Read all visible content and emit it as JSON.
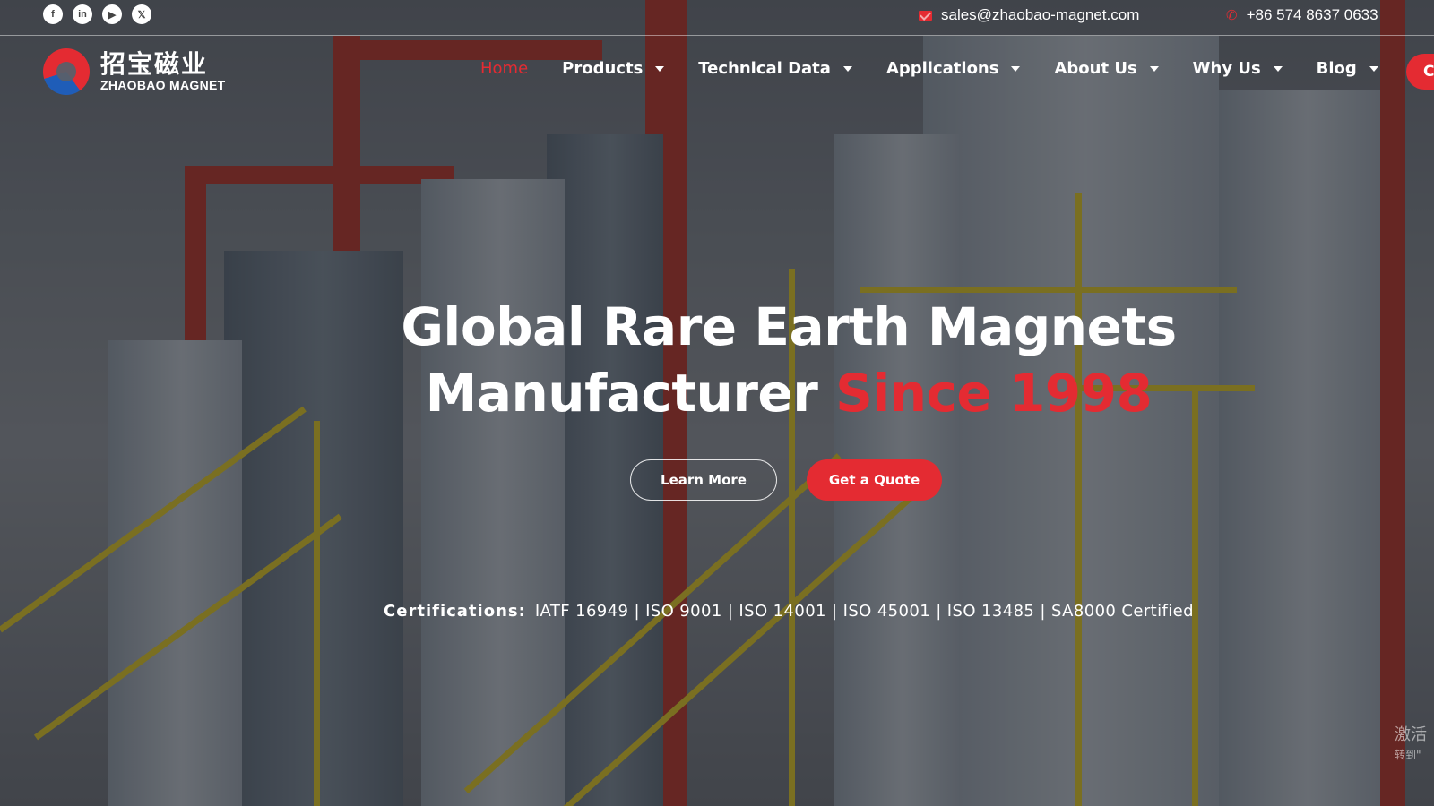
{
  "topbar": {
    "socials": [
      {
        "icon": "facebook-icon",
        "glyph": "f"
      },
      {
        "icon": "linkedin-icon",
        "glyph": "in"
      },
      {
        "icon": "youtube-icon",
        "glyph": "▶"
      },
      {
        "icon": "x-twitter-icon",
        "glyph": "𝕏"
      }
    ],
    "email": "sales@zhaobao-magnet.com",
    "phone": "+86 574 8637 0633"
  },
  "logo": {
    "cn": "招宝磁业",
    "en": "ZHAOBAO MAGNET"
  },
  "nav": {
    "items": [
      {
        "label": "Home",
        "active": true
      },
      {
        "label": "Products"
      },
      {
        "label": "Technical Data"
      },
      {
        "label": "Applications"
      },
      {
        "label": "About Us"
      },
      {
        "label": "Why Us"
      },
      {
        "label": "Blog"
      }
    ],
    "cta_label": "C"
  },
  "hero": {
    "title_line1": "Global Rare Earth Magnets",
    "title_line2_main": "Manufacturer",
    "title_line2_accent": "Since 1998",
    "learn_more": "Learn More",
    "get_quote": "Get a Quote",
    "certs_label": "Certifications:",
    "certs_text": "IATF 16949 | ISO 9001 | ISO 14001 | ISO 45001 | ISO 13485 | SA8000 Certified"
  },
  "watermark": {
    "line1": "激活",
    "line2": "转到\""
  },
  "colors": {
    "accent": "#e42b32",
    "text": "#ffffff"
  }
}
